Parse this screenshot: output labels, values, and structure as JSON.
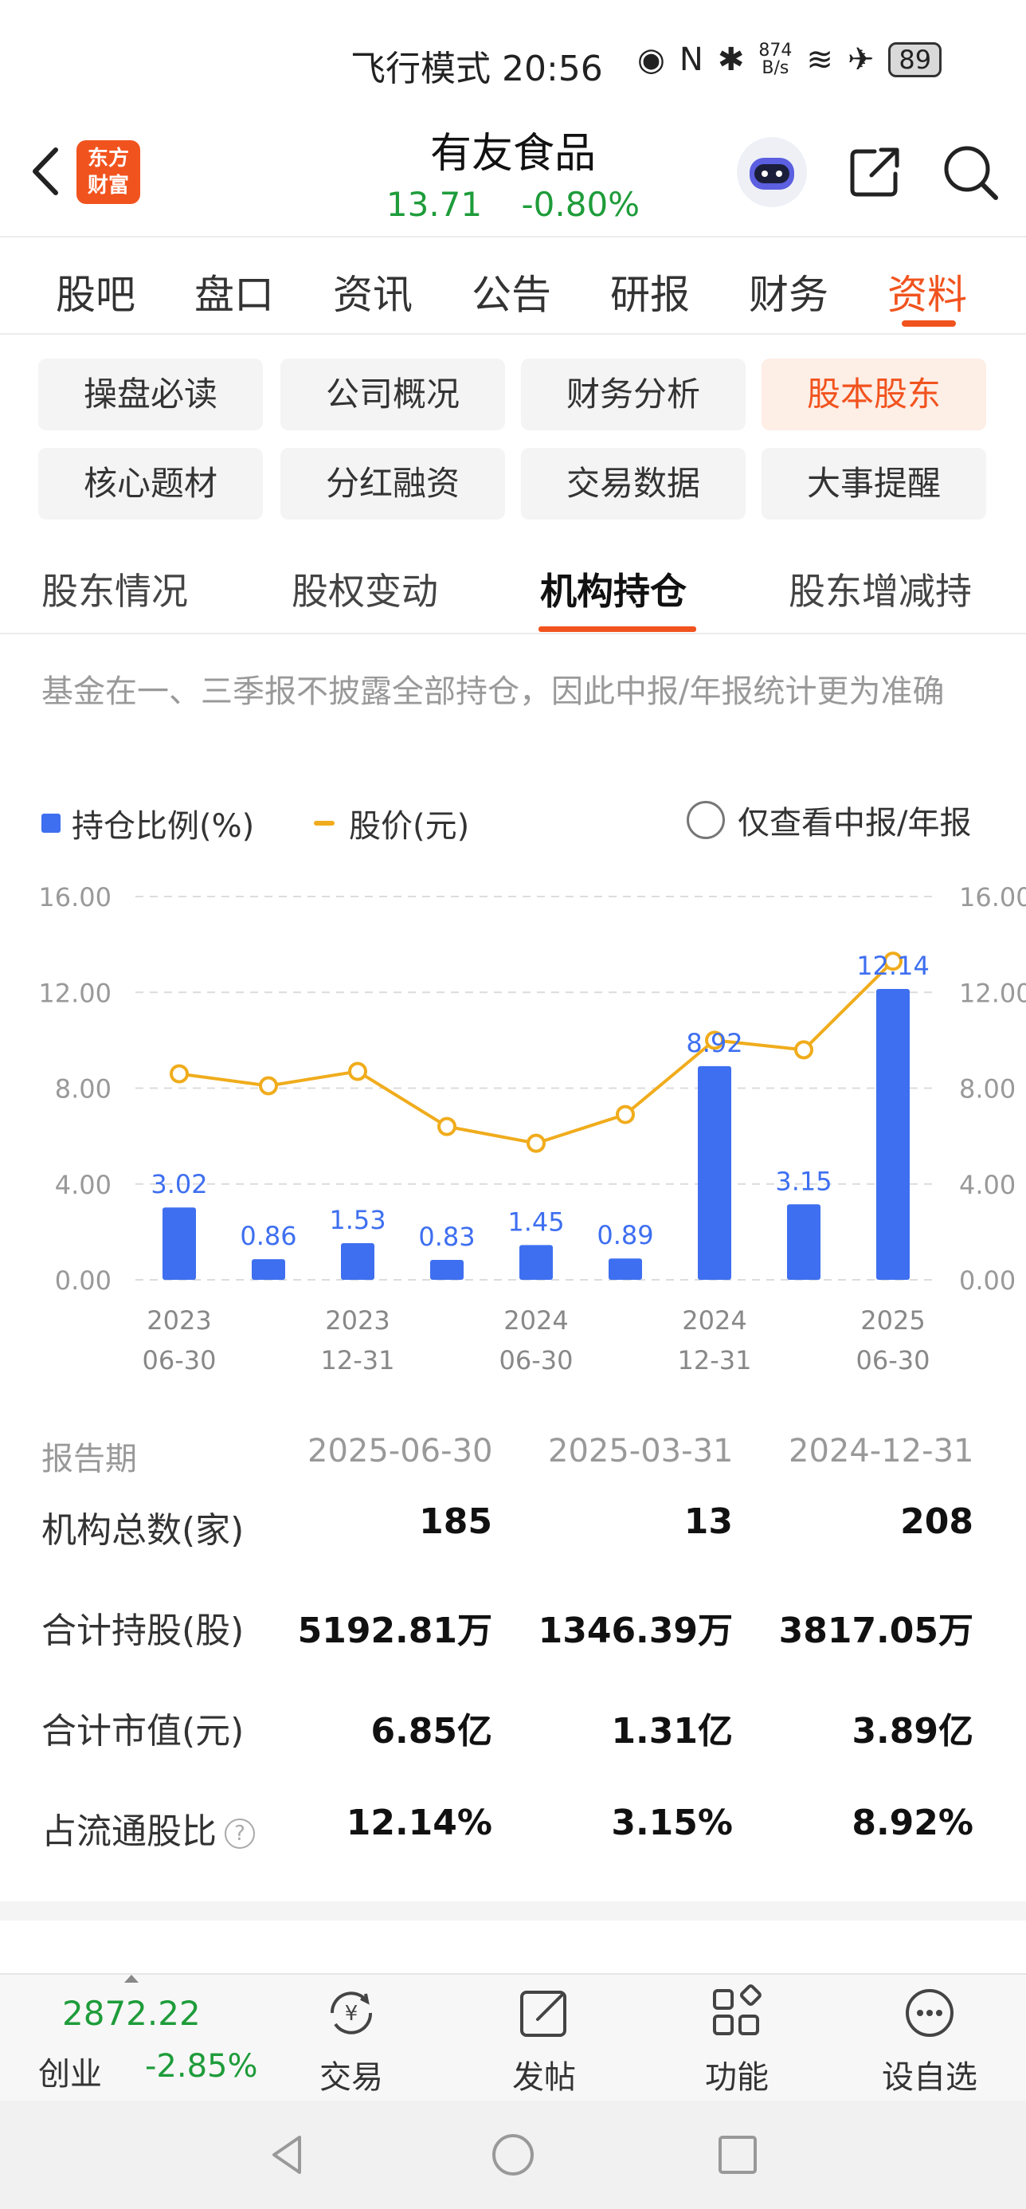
{
  "status_bar": {
    "text": "飞行模式 20:56",
    "net_speed_value": "874",
    "net_speed_unit": "B/s",
    "battery": "89"
  },
  "header": {
    "logo_line1": "东方",
    "logo_line2": "财富",
    "stock_name": "有友食品",
    "price": "13.71",
    "change": "-0.80%"
  },
  "main_tabs": [
    "股吧",
    "盘口",
    "资讯",
    "公告",
    "研报",
    "财务",
    "资料"
  ],
  "main_tab_active": "资料",
  "chips": [
    "操盘必读",
    "公司概况",
    "财务分析",
    "股本股东",
    "核心题材",
    "分红融资",
    "交易数据",
    "大事提醒"
  ],
  "chip_active": "股本股东",
  "sub_tabs": [
    "股东情况",
    "股权变动",
    "机构持仓",
    "股东增减持"
  ],
  "sub_tab_active": "机构持仓",
  "note": "基金在一、三季报不披露全部持仓，因此中报/年报统计更为准确",
  "legend": {
    "bar_label": "持仓比例(%)",
    "line_label": "股价(元)",
    "filter_label": "仅查看中报/年报"
  },
  "chart_data": {
    "type": "bar",
    "series": [
      {
        "name": "持仓比例(%)",
        "type": "bar",
        "color": "#3e6ff0",
        "values": [
          3.02,
          0.86,
          1.53,
          0.83,
          1.45,
          0.89,
          8.92,
          3.15,
          12.14
        ]
      },
      {
        "name": "股价(元)",
        "type": "line",
        "color": "#f0ac1c",
        "values": [
          8.6,
          8.1,
          8.7,
          6.4,
          5.7,
          6.9,
          10.0,
          9.6,
          13.3
        ]
      }
    ],
    "data_labels": [
      "3.02",
      "0.86",
      "1.53",
      "0.83",
      "1.45",
      "0.89",
      "8.92",
      "3.15",
      "12.14"
    ],
    "x_ticks": [
      {
        "index": 0,
        "line1": "2023",
        "line2": "06-30"
      },
      {
        "index": 2,
        "line1": "2023",
        "line2": "12-31"
      },
      {
        "index": 4,
        "line1": "2024",
        "line2": "06-30"
      },
      {
        "index": 6,
        "line1": "2024",
        "line2": "12-31"
      },
      {
        "index": 8,
        "line1": "2025",
        "line2": "06-30"
      }
    ],
    "y_ticks": [
      "0.00",
      "4.00",
      "8.00",
      "12.00",
      "16.00"
    ],
    "ylim": [
      0,
      16
    ],
    "grid": "dashed"
  },
  "table": {
    "header_label": "报告期",
    "periods": [
      "2025-06-30",
      "2025-03-31",
      "2024-12-31"
    ],
    "rows": [
      {
        "label": "机构总数(家)",
        "values": [
          "185",
          "13",
          "208"
        ]
      },
      {
        "label": "合计持股(股)",
        "values": [
          "5192.81万",
          "1346.39万",
          "3817.05万"
        ]
      },
      {
        "label": "合计市值(元)",
        "values": [
          "6.85亿",
          "1.31亿",
          "3.89亿"
        ]
      },
      {
        "label": "占流通股比",
        "values": [
          "12.14%",
          "3.15%",
          "8.92%"
        ]
      }
    ],
    "help_glyph": "?"
  },
  "bottom_bar": {
    "index_value": "2872.22",
    "index_name": "创业",
    "index_change": "-2.85%",
    "items": [
      "交易",
      "发帖",
      "功能",
      "设自选"
    ]
  }
}
